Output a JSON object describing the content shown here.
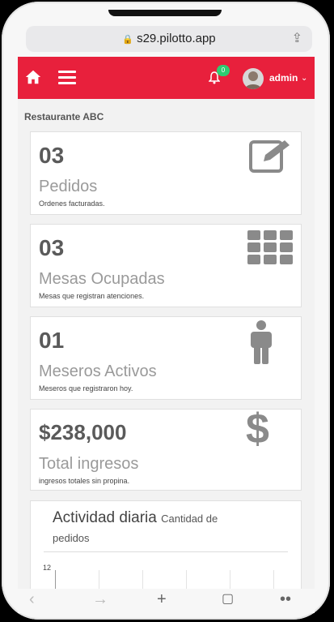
{
  "browser": {
    "url": "s29.pilotto.app"
  },
  "nav": {
    "notification_count": "0",
    "user": "admin",
    "brand_color": "#e8203c"
  },
  "restaurant": "Restaurante ABC",
  "cards": [
    {
      "number": "03",
      "label": "Pedidos",
      "desc": "Ordenes facturadas.",
      "icon": "edit-icon"
    },
    {
      "number": "03",
      "label": "Mesas Ocupadas",
      "desc": "Mesas que registran atenciones.",
      "icon": "grid-icon"
    },
    {
      "number": "01",
      "label": "Meseros Activos",
      "desc": "Meseros que registraron hoy.",
      "icon": "person-icon"
    },
    {
      "number": "$238,000",
      "label": "Total ingresos",
      "desc": "ingresos totales sin propina.",
      "icon": "dollar-icon"
    }
  ],
  "activity": {
    "title": "Actividad diaria",
    "subtitle_part1": "Cantidad de",
    "subtitle_part2": "pedidos",
    "y_tick": "12"
  }
}
